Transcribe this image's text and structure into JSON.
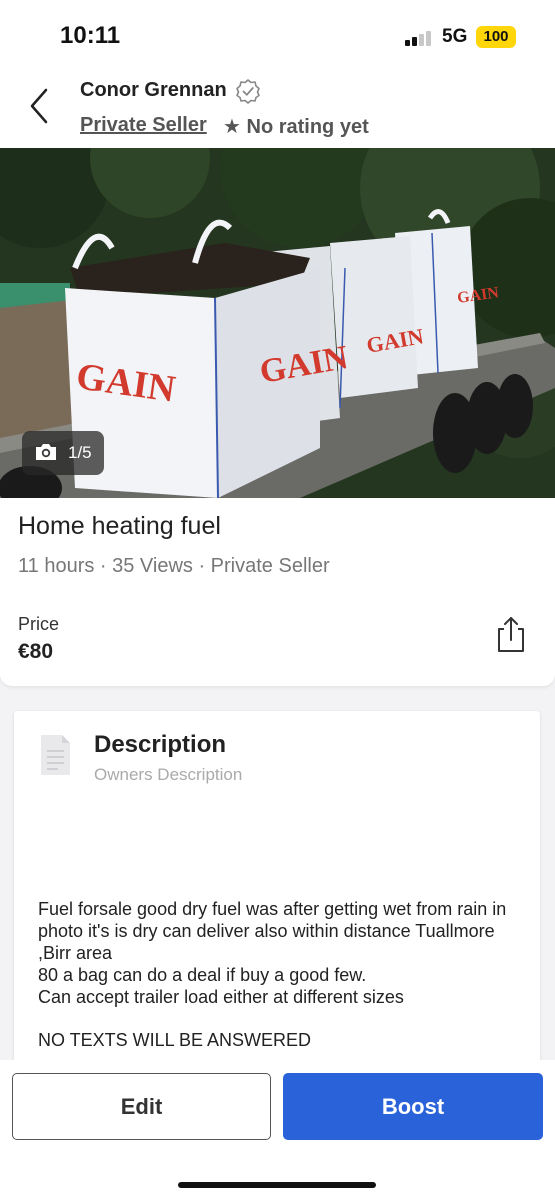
{
  "status_bar": {
    "time": "10:11",
    "network": "5G",
    "battery": "100",
    "accent_color": "#ffd60a"
  },
  "header": {
    "seller_name": "Conor Grennan",
    "seller_type": "Private Seller",
    "rating_star": "★",
    "rating_text": "No rating yet",
    "back_icon": "chevron-left-icon",
    "verified_icon": "verified-badge-icon"
  },
  "photo": {
    "counter": "1/5",
    "camera_icon": "camera-icon",
    "bag_brand": "GAIN"
  },
  "listing": {
    "title": "Home heating fuel",
    "meta": "11 hours · 35 Views · Private Seller",
    "price_label": "Price",
    "price": "€80",
    "share_icon": "share-icon"
  },
  "description": {
    "heading": "Description",
    "subheading": "Owners Description",
    "body": "Fuel forsale good dry fuel was after getting wet from rain in photo it's is dry can deliver also within distance Tuallmore ,Birr area\n 80 a bag can do a deal if buy a good few.\nCan accept trailer load either at different sizes",
    "note": "NO TEXTS WILL BE ANSWERED",
    "doc_icon": "document-icon"
  },
  "actions": {
    "edit_label": "Edit",
    "boost_label": "Boost",
    "boost_color": "#2962d9"
  }
}
